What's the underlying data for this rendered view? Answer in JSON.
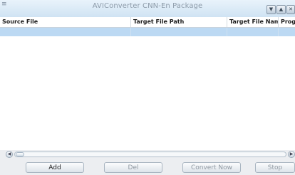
{
  "window": {
    "title": "AVIConverter CNN-En Package",
    "controls": [
      "minimize-icon",
      "maximize-icon",
      "close-icon"
    ]
  },
  "table": {
    "columns": [
      "Source File",
      "Target File Path",
      "Target File Name",
      "Prog"
    ],
    "selected_row": [
      "",
      "",
      "",
      ""
    ]
  },
  "toolbar": {
    "add_label": "Add",
    "del_label": "Del",
    "convert_label": "Convert Now",
    "stop_label": "Stop"
  },
  "colors": {
    "accent": "#bcd9f3",
    "window": "#eceef1"
  }
}
